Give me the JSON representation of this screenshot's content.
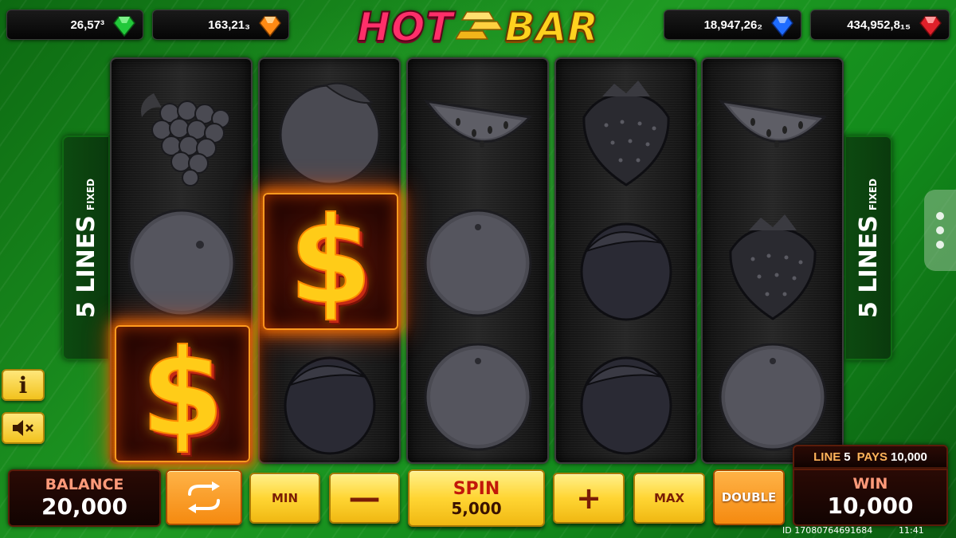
{
  "jackpots": [
    {
      "value": "26,57³",
      "gem": "green-gem",
      "color": "#22c83a"
    },
    {
      "value": "163,21₃",
      "gem": "orange-gem",
      "color": "#ff8a14"
    },
    {
      "value": "18,947,26₂",
      "gem": "blue-gem",
      "color": "#1e6cff"
    },
    {
      "value": "434,952,8₁₅",
      "gem": "red-gem",
      "color": "#e0202a"
    }
  ],
  "logo": {
    "word1": "HOT",
    "word2": "BAR"
  },
  "side_lines": {
    "count": "5 LINES",
    "label": "FIXED"
  },
  "reels": [
    [
      "grapes-icon",
      "orange-icon",
      "dollar-icon"
    ],
    [
      "orange-icon",
      "dollar-icon",
      "plum-icon"
    ],
    [
      "watermelon-icon",
      "orange-icon",
      "orange-icon"
    ],
    [
      "strawberry-icon",
      "plum-icon",
      "plum-icon"
    ],
    [
      "watermelon-icon",
      "strawberry-icon",
      "orange-icon"
    ]
  ],
  "dollar_symbol": "$",
  "controls": {
    "balance_label": "BALANCE",
    "balance_value": "20,000",
    "min_label": "MIN",
    "minus_label": "—",
    "spin_label": "SPIN",
    "spin_bet": "5,000",
    "plus_label": "+",
    "max_label": "MAX",
    "double_label": "DOUBLE",
    "line_label": "LINE",
    "line_number": "5",
    "pays_label": "PAYS",
    "pays_value": "10,000",
    "win_label": "WIN",
    "win_value": "10,000"
  },
  "info_label": "i",
  "footer": {
    "round_id": "ID 17080764691684",
    "time": "11:41"
  },
  "colors": {
    "accent": "#ffd533",
    "background": "#1f9a23",
    "panel": "#2a0a05"
  }
}
